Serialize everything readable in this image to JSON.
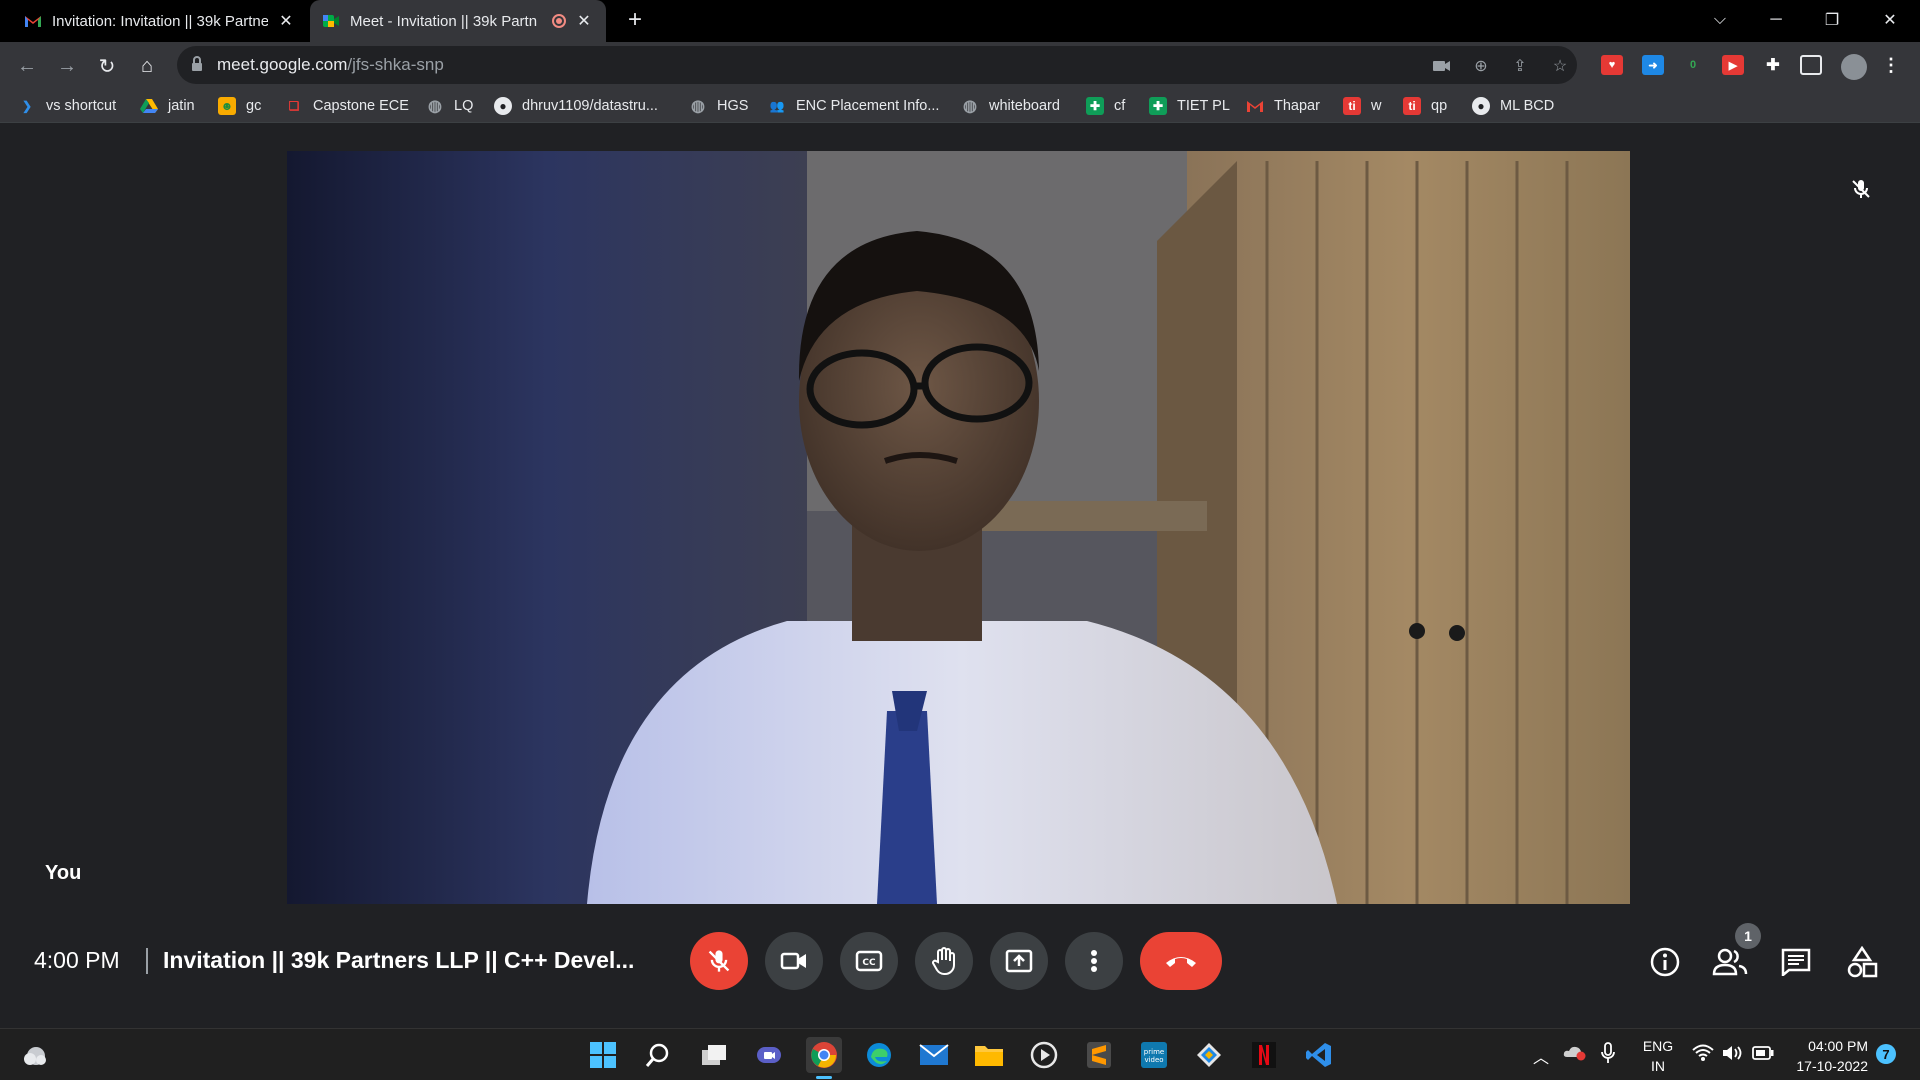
{
  "browser": {
    "tabs": [
      {
        "title": "Invitation: Invitation || 39k Partne",
        "favicon": "gmail-icon"
      },
      {
        "title": "Meet - Invitation || 39k Partn",
        "favicon": "meet-icon",
        "recording": true
      }
    ],
    "url_host": "meet.google.com",
    "url_path": "/jfs-shka-snp"
  },
  "bookmarks": [
    {
      "label": "vs shortcut",
      "icon": "vscode-icon"
    },
    {
      "label": "jatin",
      "icon": "drive-icon"
    },
    {
      "label": "gc",
      "icon": "classroom-icon"
    },
    {
      "label": "Capstone ECE",
      "icon": "bookmark-red-icon"
    },
    {
      "label": "LQ",
      "icon": "globe-icon"
    },
    {
      "label": "dhruv1109/datastru...",
      "icon": "github-icon"
    },
    {
      "label": "HGS",
      "icon": "globe-icon"
    },
    {
      "label": "ENC Placement Info...",
      "icon": "groups-icon"
    },
    {
      "label": "whiteboard",
      "icon": "globe-icon"
    },
    {
      "label": "cf",
      "icon": "sheets-icon"
    },
    {
      "label": "TIET PL",
      "icon": "sheets-icon"
    },
    {
      "label": "Thapar",
      "icon": "gmail-icon"
    },
    {
      "label": "w",
      "icon": "ti-icon"
    },
    {
      "label": "qp",
      "icon": "ti-icon"
    },
    {
      "label": "ML BCD",
      "icon": "github-icon"
    }
  ],
  "meet": {
    "self_label": "You",
    "time": "4:00 PM",
    "meeting_title": "Invitation || 39k Partners LLP || C++ Devel...",
    "participant_count": "1"
  },
  "taskbar": {
    "language": "ENG",
    "region": "IN",
    "time": "04:00 PM",
    "date": "17-10-2022",
    "notification_count": "7"
  },
  "colors": {
    "end_call": "#ea4335",
    "mic_off": "#ea4335",
    "button_bg": "#3c4043",
    "stage_bg": "#202124"
  }
}
